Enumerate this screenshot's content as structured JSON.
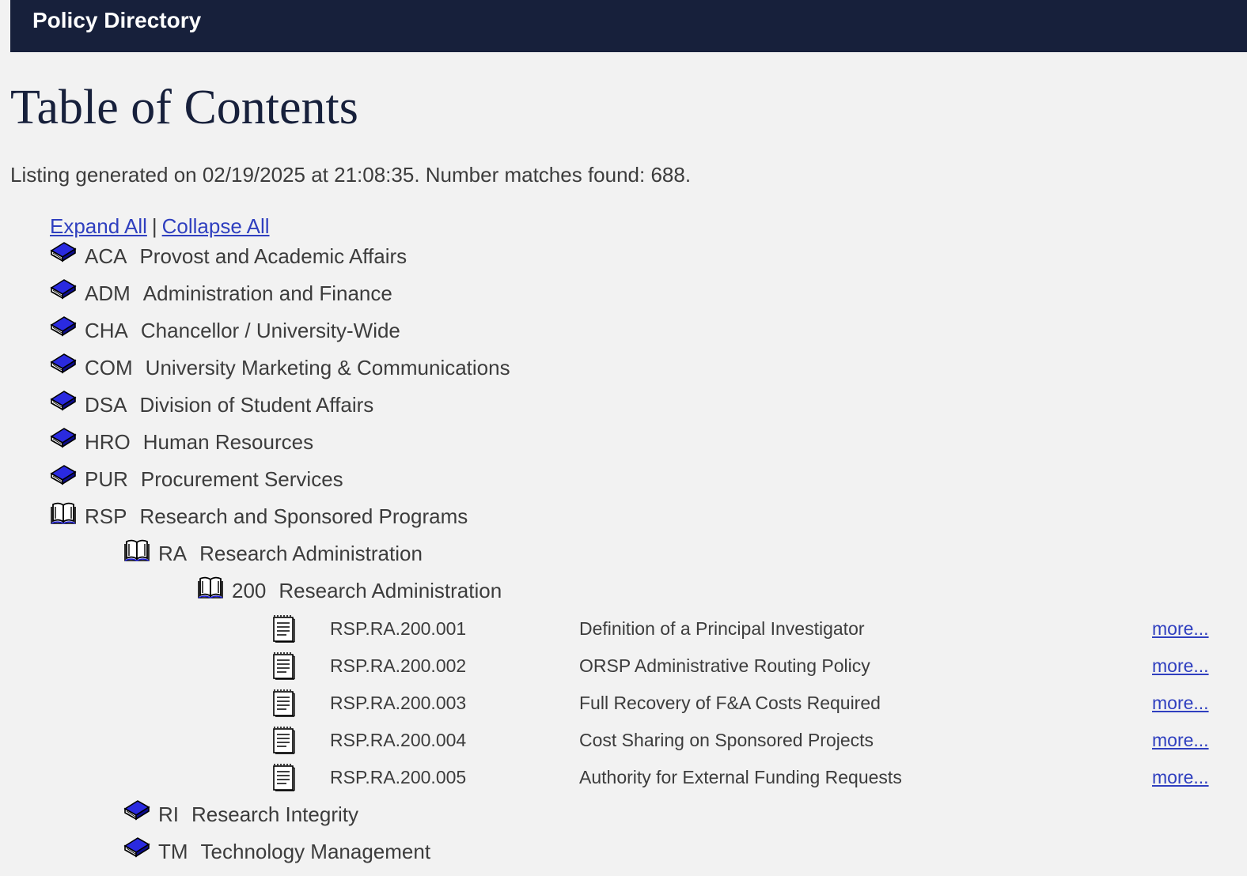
{
  "header": {
    "title": "Policy Directory"
  },
  "page": {
    "title": "Table of Contents",
    "listing_info": "Listing generated on 02/19/2025 at 21:08:35. Number matches found: 688."
  },
  "controls": {
    "expand_all": "Expand All",
    "separator": "|",
    "collapse_all": "Collapse All"
  },
  "tree": [
    {
      "code": "ACA",
      "label": "Provost and Academic Affairs",
      "icon": "closed-book-icon"
    },
    {
      "code": "ADM",
      "label": "Administration and Finance",
      "icon": "closed-book-icon"
    },
    {
      "code": "CHA",
      "label": "Chancellor / University-Wide",
      "icon": "closed-book-icon"
    },
    {
      "code": "COM",
      "label": "University Marketing & Communications",
      "icon": "closed-book-icon"
    },
    {
      "code": "DSA",
      "label": "Division of Student Affairs",
      "icon": "closed-book-icon"
    },
    {
      "code": "HRO",
      "label": "Human Resources",
      "icon": "closed-book-icon"
    },
    {
      "code": "PUR",
      "label": "Procurement Services",
      "icon": "closed-book-icon"
    },
    {
      "code": "RSP",
      "label": "Research and Sponsored Programs",
      "icon": "open-book-icon"
    },
    {
      "code": "RA",
      "label": "Research Administration",
      "icon": "open-book-icon"
    },
    {
      "code": "200",
      "label": "Research Administration",
      "icon": "open-book-icon"
    },
    {
      "code": "RI",
      "label": "Research Integrity",
      "icon": "closed-book-icon"
    },
    {
      "code": "TM",
      "label": "Technology Management",
      "icon": "closed-book-icon"
    }
  ],
  "documents": [
    {
      "id": "RSP.RA.200.001",
      "title": "Definition of a Principal Investigator",
      "more": "more..."
    },
    {
      "id": "RSP.RA.200.002",
      "title": "ORSP Administrative Routing Policy",
      "more": "more..."
    },
    {
      "id": "RSP.RA.200.003",
      "title": "Full Recovery of F&A Costs Required",
      "more": "more..."
    },
    {
      "id": "RSP.RA.200.004",
      "title": "Cost Sharing on Sponsored Projects",
      "more": "more..."
    },
    {
      "id": "RSP.RA.200.005",
      "title": "Authority for External Funding Requests",
      "more": "more..."
    }
  ],
  "colors": {
    "header_bg": "#17203b",
    "page_bg": "#f2f2f2",
    "link": "#2f3fbf",
    "book_blue": "#1d1ddb"
  }
}
